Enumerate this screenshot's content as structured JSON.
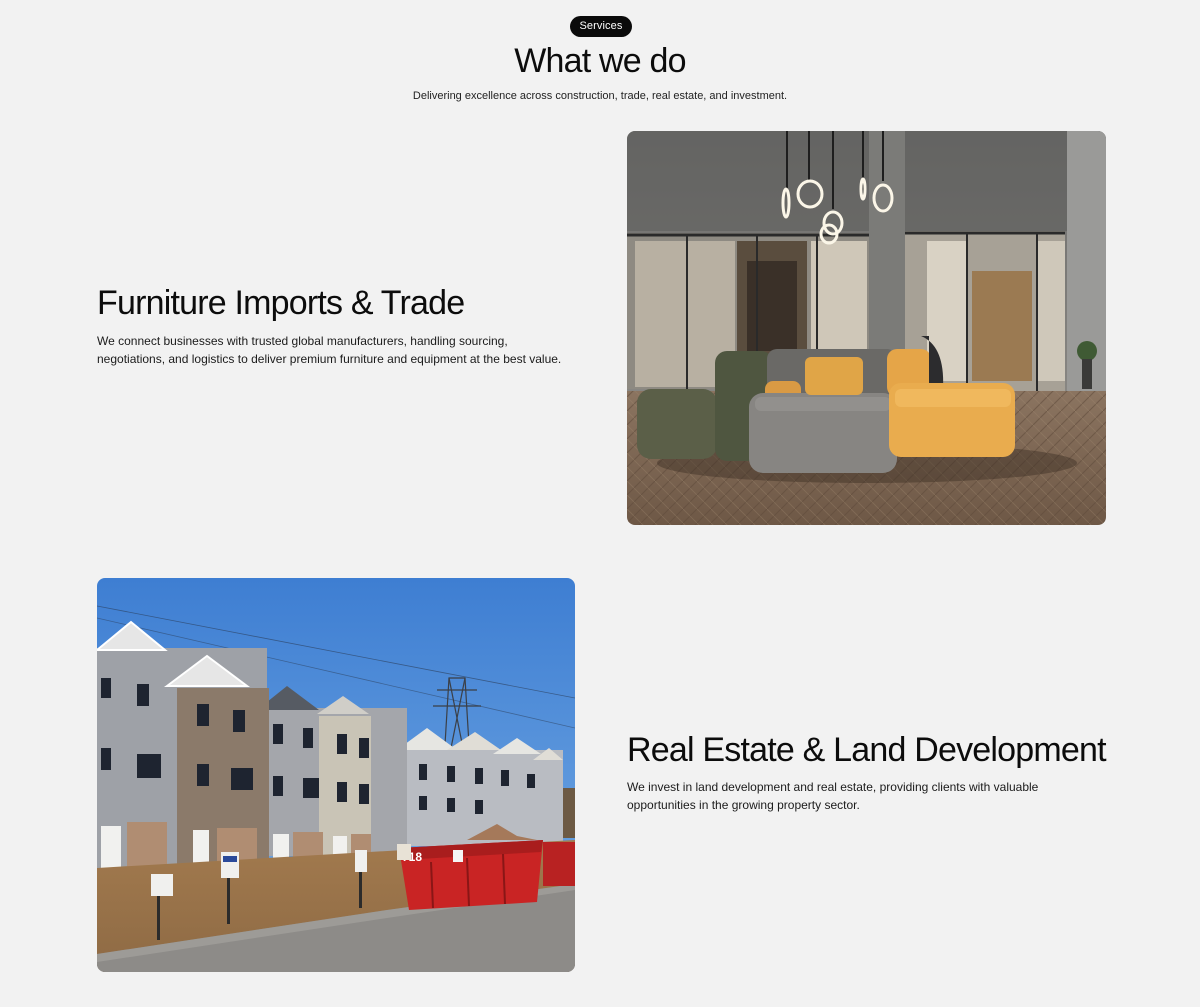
{
  "header": {
    "badge": "Services",
    "title": "What we do",
    "subtitle": "Delivering excellence across construction, trade, real estate, and investment."
  },
  "services": [
    {
      "title": "Furniture Imports & Trade",
      "description": "We connect businesses with trusted global manufacturers, handling sourcing, negotiations, and logistics to deliver premium furniture and equipment at the best value.",
      "image_label": "showroom-sofa-photo"
    },
    {
      "title": "Real Estate & Land Development",
      "description": "We invest in land development and real estate, providing clients with valuable opportunities in the growing property sector.",
      "image_label": "townhouse-construction-photo",
      "dumpster_number": "718"
    }
  ]
}
